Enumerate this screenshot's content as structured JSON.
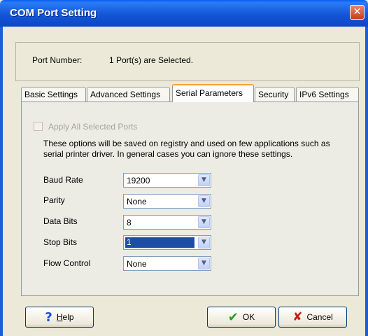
{
  "window": {
    "title": "COM Port Setting",
    "close_glyph": "✕"
  },
  "port": {
    "label": "Port Number:",
    "value": "1 Port(s) are Selected."
  },
  "tabs": [
    {
      "label": "Basic Settings"
    },
    {
      "label": "Advanced Settings"
    },
    {
      "label": "Serial Parameters",
      "active": true
    },
    {
      "label": "Security"
    },
    {
      "label": "IPv6 Settings"
    }
  ],
  "panel": {
    "apply_all_label": "Apply All Selected Ports",
    "apply_all_checked": false,
    "apply_all_enabled": false,
    "description": "These options will be saved on registry and used on few applications such as serial printer driver. In general cases you can ignore these settings.",
    "fields": [
      {
        "label": "Baud Rate",
        "value": "19200"
      },
      {
        "label": "Parity",
        "value": "None"
      },
      {
        "label": "Data Bits",
        "value": "8"
      },
      {
        "label": "Stop Bits",
        "value": "1",
        "focused": true
      },
      {
        "label": "Flow Control",
        "value": "None"
      }
    ]
  },
  "buttons": {
    "help": {
      "icon": "?",
      "label_underlined": "H",
      "label_rest": "elp"
    },
    "ok": {
      "icon": "✔",
      "label_underlined": "",
      "label_rest": "OK"
    },
    "cancel": {
      "icon": "✘",
      "label_underlined": "",
      "label_rest": "Cancel"
    }
  },
  "colors": {
    "titlebar": "#0a47c8",
    "active_tab_accent": "#f4a52c",
    "selection": "#1c4ea6"
  }
}
